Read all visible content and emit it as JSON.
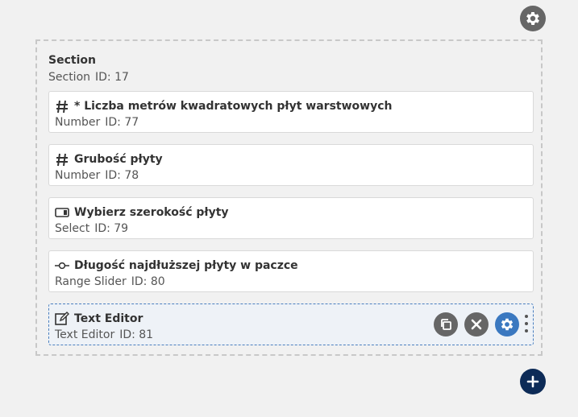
{
  "toolbar": {
    "settings_icon": "gear-icon"
  },
  "section": {
    "title": "Section",
    "type_label": "Section",
    "id_label": "ID: 17",
    "fields": [
      {
        "icon": "hash-icon",
        "title": "* Liczba metrów kwadratowych płyt warstwowych",
        "type_label": "Number",
        "id_label": "ID: 77"
      },
      {
        "icon": "hash-icon",
        "title": "Grubość płyty",
        "type_label": "Number",
        "id_label": "ID: 78"
      },
      {
        "icon": "select-icon",
        "title": "Wybierz szerokość płyty",
        "type_label": "Select",
        "id_label": "ID: 79"
      },
      {
        "icon": "range-slider-icon",
        "title": "Długość najdłuższej płyty w paczce",
        "type_label": "Range Slider",
        "id_label": "ID: 80"
      },
      {
        "icon": "text-editor-icon",
        "title": "Text Editor",
        "type_label": "Text Editor",
        "id_label": "ID: 81"
      }
    ]
  },
  "active_field_actions": [
    "duplicate-icon",
    "close-icon",
    "gear-icon",
    "drag-handle-icon"
  ],
  "colors": {
    "accent": "#3a78c0",
    "add_button": "#0d2b57",
    "icon_gray": "#666666"
  },
  "add_button_icon": "plus-icon"
}
